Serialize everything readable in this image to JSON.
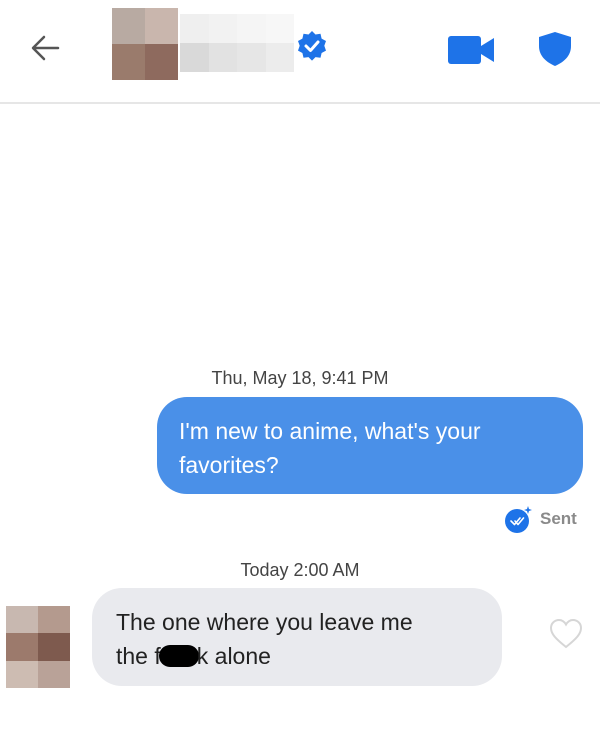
{
  "header": {
    "icons": {
      "back": "arrow-left-icon",
      "verified": "verified-check-icon",
      "video": "video-camera-icon",
      "safety": "shield-icon"
    },
    "accent_color": "#1e73e8"
  },
  "messages": [
    {
      "timestamp": "Thu, May 18, 9:41 PM",
      "direction": "sent",
      "text": "I'm new to anime, what's your favorites?",
      "status": "Sent",
      "bubble_color": "#4a90e8"
    },
    {
      "timestamp": "Today 2:00 AM",
      "direction": "received",
      "text_part1": "The one where you leave me",
      "text_part2_before_redaction": "the f",
      "text_part2_after_redaction": "k alone",
      "bubble_color": "#e9eaee",
      "like_icon": "heart-outline-icon"
    }
  ]
}
